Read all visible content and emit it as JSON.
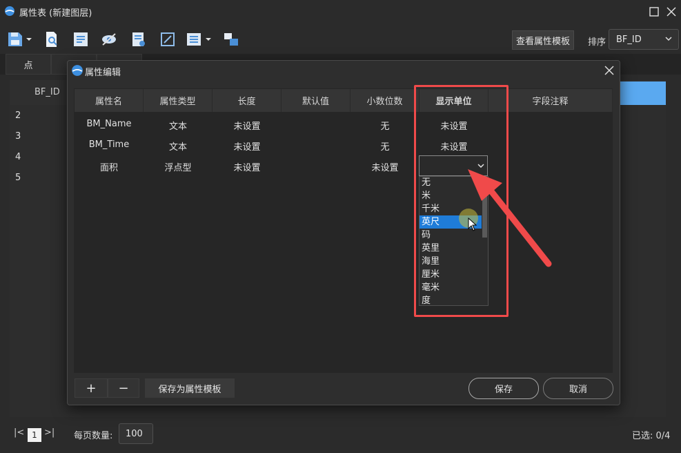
{
  "window": {
    "title": "属性表 (新建图层)"
  },
  "toolbar": {
    "template_button": "查看属性模板",
    "sort_label": "排序",
    "sort_value": "BF_ID",
    "icons": [
      "save-icon",
      "zoom-to-icon",
      "export-icon",
      "hide-icon",
      "field-calc-icon",
      "select-icon",
      "columns-icon",
      "layers-icon"
    ]
  },
  "tabs": [
    {
      "label": "点"
    },
    {
      "label": ""
    },
    {
      "label": ""
    }
  ],
  "table": {
    "column_header": "BF_ID",
    "rows": [
      "2",
      "3",
      "4",
      "5"
    ]
  },
  "status": {
    "first_page": "|<",
    "page": "1",
    "last_page": ">|",
    "per_page_label": "每页数量:",
    "per_page_value": "100",
    "selected": "已选: 0/4"
  },
  "dialog": {
    "title": "属性编辑",
    "columns": [
      "属性名",
      "属性类型",
      "长度",
      "默认值",
      "小数位数",
      "显示单位",
      "字段注释"
    ],
    "rows": [
      {
        "name": "BM_Name",
        "type": "文本",
        "length": "未设置",
        "default": "",
        "decimals": "无",
        "unit": "未设置",
        "comment": ""
      },
      {
        "name": "BM_Time",
        "type": "文本",
        "length": "未设置",
        "default": "",
        "decimals": "无",
        "unit": "未设置",
        "comment": ""
      },
      {
        "name": "面积",
        "type": "浮点型",
        "length": "未设置",
        "default": "",
        "decimals": "未设置",
        "unit": "",
        "comment": ""
      }
    ],
    "unit_options": [
      "无",
      "米",
      "千米",
      "英尺",
      "码",
      "英里",
      "海里",
      "厘米",
      "毫米",
      "度"
    ],
    "unit_selected_index": 3,
    "add_label": "+",
    "remove_label": "−",
    "save_template_label": "保存为属性模板",
    "save_label": "保存",
    "cancel_label": "取消"
  },
  "colors": {
    "accent": "#1f7cd8",
    "annotation": "#f04a4a",
    "header_selected": "#5aa9f0"
  }
}
